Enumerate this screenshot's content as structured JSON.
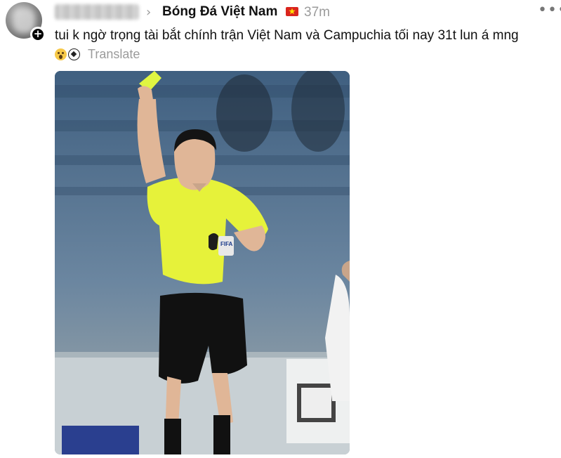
{
  "post": {
    "author_username": "",
    "group_name": "Bóng Đá Việt Nam",
    "flag_icon": "vietnam-flag-icon",
    "time_ago": "37m",
    "more_label": "•••",
    "text": "tui k ngờ trọng tài bắt chính trận Việt Nam và Campuchia tối nay 31t lun á mng",
    "emojis": [
      "astonished-face-emoji",
      "soccer-ball-emoji"
    ],
    "translate_label": "Translate",
    "plus_label": "+"
  },
  "photo": {
    "badge_text": "FIFA",
    "description_icon": "referee-photo"
  },
  "colors": {
    "meta_gray": "#9b9b9b",
    "referee_shirt": "#e6f23a",
    "flag_red": "#da251d",
    "flag_star": "#ffde00"
  }
}
